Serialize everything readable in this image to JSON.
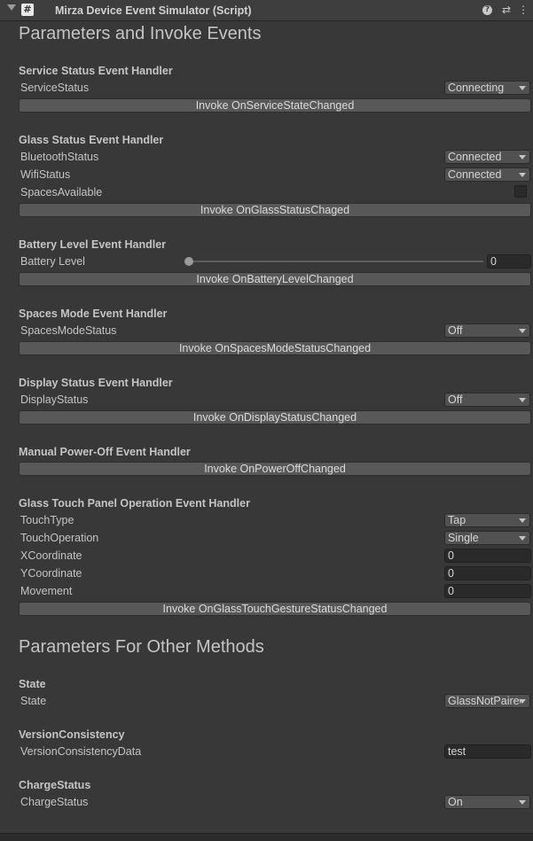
{
  "header": {
    "title": "Mirza Device Event Simulator (Script)",
    "script_icon_glyph": "#",
    "help_glyph": "?",
    "presets_glyph": "⇄",
    "menu_glyph": "⋮"
  },
  "sections": {
    "invoke_title": "Parameters and Invoke Events",
    "other_title": "Parameters For Other Methods"
  },
  "service": {
    "title": "Service Status Event Handler",
    "label": "ServiceStatus",
    "value": "Connecting",
    "button": "Invoke OnServiceStateChanged"
  },
  "glass": {
    "title": "Glass Status Event Handler",
    "bt_label": "BluetoothStatus",
    "bt_value": "Connected",
    "wifi_label": "WifiStatus",
    "wifi_value": "Connected",
    "spaces_label": "SpacesAvailable",
    "spaces_checked": false,
    "button": "Invoke OnGlassStatusChaged"
  },
  "battery": {
    "title": "Battery Level Event Handler",
    "label": "Battery Level",
    "value": "0",
    "slider_fraction": 0,
    "button": "Invoke OnBatteryLevelChanged"
  },
  "spaces_mode": {
    "title": "Spaces Mode Event Handler",
    "label": "SpacesModeStatus",
    "value": "Off",
    "button": "Invoke OnSpacesModeStatusChanged"
  },
  "display": {
    "title": "Display Status Event Handler",
    "label": "DisplayStatus",
    "value": "Off",
    "button": "Invoke OnDisplayStatusChanged"
  },
  "power_off": {
    "title": "Manual Power-Off Event Handler",
    "button": "Invoke OnPowerOffChanged"
  },
  "touch": {
    "title": "Glass Touch Panel Operation Event Handler",
    "type_label": "TouchType",
    "type_value": "Tap",
    "op_label": "TouchOperation",
    "op_value": "Single",
    "x_label": "XCoordinate",
    "x_value": "0",
    "y_label": "YCoordinate",
    "y_value": "0",
    "move_label": "Movement",
    "move_value": "0",
    "button": "Invoke OnGlassTouchGestureStatusChanged"
  },
  "state": {
    "title": "State",
    "label": "State",
    "value": "GlassNotPaired"
  },
  "version": {
    "title": "VersionConsistency",
    "label": "VersionConsistencyData",
    "value": "test"
  },
  "charge": {
    "title": "ChargeStatus",
    "label": "ChargeStatus",
    "value": "On"
  }
}
